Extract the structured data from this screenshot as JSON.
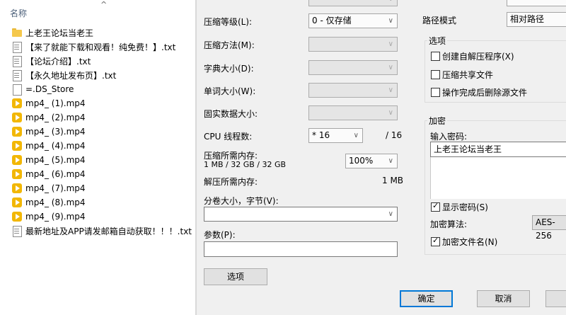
{
  "explorer": {
    "column_name": "名称",
    "files": [
      {
        "name": "上老王论坛当老王",
        "icon": "folder-icon"
      },
      {
        "name": "【来了就能下载和观看！纯免费！】.txt",
        "icon": "text-file-icon"
      },
      {
        "name": "【论坛介绍】.txt",
        "icon": "text-file-icon"
      },
      {
        "name": "【永久地址发布页】.txt",
        "icon": "text-file-icon"
      },
      {
        "name": "=.DS_Store",
        "icon": "blank-file-icon"
      },
      {
        "name": "mp4_ (1).mp4",
        "icon": "media-file-icon"
      },
      {
        "name": "mp4_ (2).mp4",
        "icon": "media-file-icon"
      },
      {
        "name": "mp4_ (3).mp4",
        "icon": "media-file-icon"
      },
      {
        "name": "mp4_ (4).mp4",
        "icon": "media-file-icon"
      },
      {
        "name": "mp4_ (5).mp4",
        "icon": "media-file-icon"
      },
      {
        "name": "mp4_ (6).mp4",
        "icon": "media-file-icon"
      },
      {
        "name": "mp4_ (7).mp4",
        "icon": "media-file-icon"
      },
      {
        "name": "mp4_ (8).mp4",
        "icon": "media-file-icon"
      },
      {
        "name": "mp4_ (9).mp4",
        "icon": "media-file-icon"
      },
      {
        "name": "最新地址及APP请发邮箱自动获取！！！.txt",
        "icon": "text-file-icon"
      }
    ]
  },
  "dialog": {
    "compression_level": {
      "label": "压缩等级(L):",
      "value": "0 - 仅存储"
    },
    "compression_method": {
      "label": "压缩方法(M):"
    },
    "dictionary_size": {
      "label": "字典大小(D):"
    },
    "word_size": {
      "label": "单词大小(W):"
    },
    "solid_block_size": {
      "label": "固实数据大小:"
    },
    "cpu_threads": {
      "label": "CPU 线程数:",
      "value": "* 16",
      "total": "/ 16"
    },
    "memory_compress": {
      "label": "压缩所需内存:",
      "detail": "1 MB / 32 GB / 32 GB",
      "percent": "100%"
    },
    "memory_decompress": {
      "label": "解压所需内存:",
      "value": "1 MB"
    },
    "split_volume": {
      "label": "分卷大小，字节(V):",
      "value": ""
    },
    "parameters": {
      "label": "参数(P):",
      "value": ""
    },
    "options_button": "选项",
    "path_mode": {
      "label": "路径模式",
      "value": "相对路径"
    },
    "options_group": {
      "title": "选项",
      "create_sfx": {
        "label": "创建自解压程序(X)",
        "checked": false
      },
      "compress_shared": {
        "label": "压缩共享文件",
        "checked": false
      },
      "delete_after": {
        "label": "操作完成后删除源文件",
        "checked": false
      }
    },
    "encryption_group": {
      "title": "加密",
      "password_label": "输入密码:",
      "password_value": "上老王论坛当老王",
      "show_password": {
        "label": "显示密码(S)",
        "checked": true
      },
      "method_label": "加密算法:",
      "method_value": "AES-256",
      "encrypt_names": {
        "label": "加密文件名(N)",
        "checked": true
      }
    },
    "ok_button": "确定",
    "cancel_button": "取消"
  }
}
